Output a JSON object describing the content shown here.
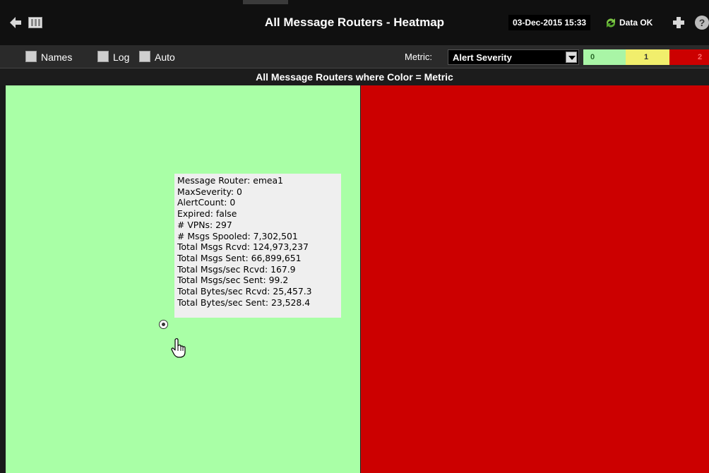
{
  "header": {
    "title": "All Message Routers - Heatmap",
    "timestamp": "03-Dec-2015 15:33",
    "status": "Data OK",
    "help_glyph": "?"
  },
  "controls": {
    "names_label": "Names",
    "log_label": "Log",
    "auto_label": "Auto",
    "metric_label": "Metric:",
    "metric_value": "Alert Severity",
    "legend": [
      {
        "label": "0",
        "color": "#a9f5a6"
      },
      {
        "label": "1",
        "color": "#f1ee6c"
      },
      {
        "label": "2",
        "color": "#cc0000"
      }
    ]
  },
  "heatmap": {
    "title": "All Message Routers where Color = Metric",
    "cells": [
      {
        "name": "emea1",
        "severity": 0,
        "color": "#a9ffa6"
      },
      {
        "name": "",
        "severity": 2,
        "color": "#cc0000"
      }
    ]
  },
  "tooltip": {
    "lines": [
      "Message Router: emea1",
      "MaxSeverity: 0",
      "AlertCount: 0",
      "Expired: false",
      "# VPNs: 297",
      "# Msgs Spooled: 7,302,501",
      "Total Msgs Rcvd: 124,973,237",
      "Total Msgs Sent: 66,899,651",
      "Total Msgs/sec Rcvd: 167.9",
      "Total Msgs/sec Sent: 99.2",
      "Total Bytes/sec Rcvd: 25,457.3",
      "Total Bytes/sec Sent: 23,528.4"
    ]
  }
}
